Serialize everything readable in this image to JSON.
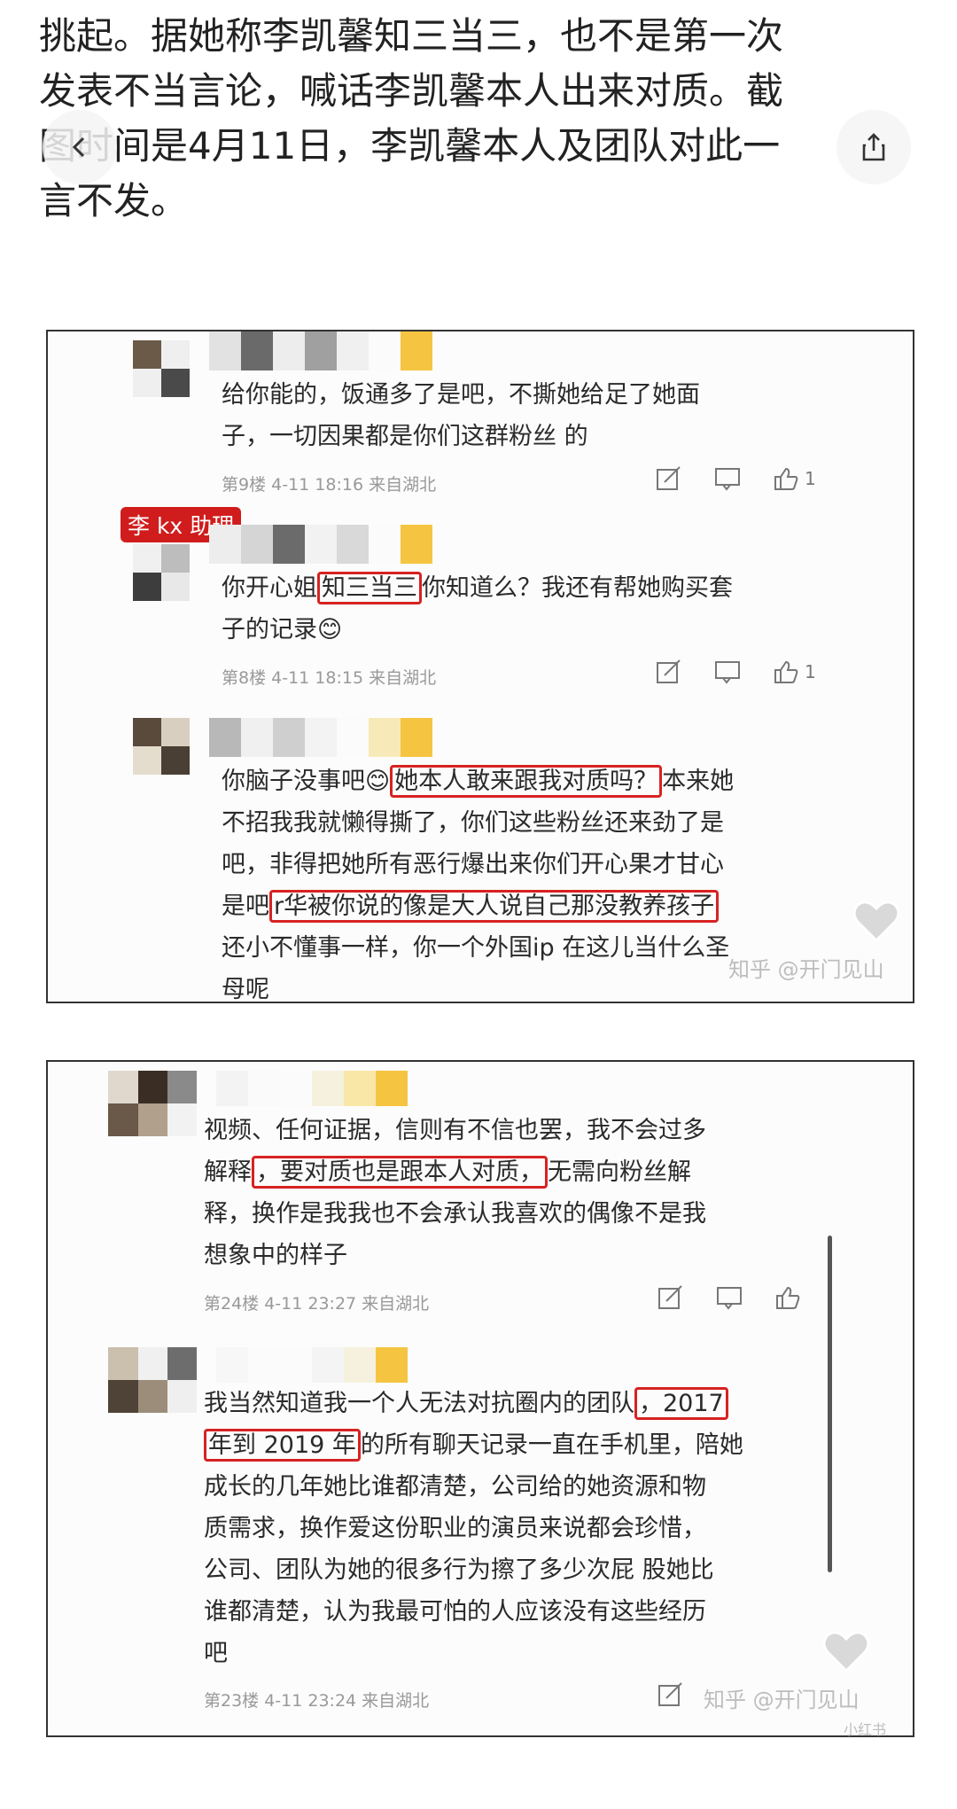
{
  "article": {
    "lines": [
      "挑起。据她称李凯馨知三当三，也不是第一次",
      "发表不当言论，喊话李凯馨本人出来对质。截",
      "图时间是4月11日，李凯馨本人及团队对此一",
      "言不发。"
    ]
  },
  "nav": {
    "back_icon": "chevron-left-icon",
    "share_icon": "share-icon"
  },
  "screenshot1": {
    "c1": {
      "line1": "给你能的，饭通多了是吧，不撕她给足了她面",
      "line2": "子，一切因果都是你们这群粉丝    的",
      "meta": "第9楼 4-11 18:16 来自湖北",
      "likes": "1"
    },
    "tag": "李 kx 助理",
    "c2": {
      "pre": "你开心姐",
      "hl": "知三当三",
      "post": "你知道么？我还有帮她购买套",
      "line2": "子的记录😊",
      "meta": "第8楼 4-11 18:15 来自湖北",
      "likes": "1"
    },
    "c3": {
      "pre": "你脑子没事吧😊",
      "hl1": "她本人敢来跟我对质吗？",
      "post": "本来她",
      "line2": "不招我我就懒得撕了，你们这些粉丝还来劲了是",
      "line3": "吧，非得把她所有恶行爆出来你们开心果才甘心",
      "pre4": "是吧",
      "hl2": "r华被你说的像是大人说自己那没教养孩子",
      "line5": "还小不懂事一样，你一个外国ip 在这儿当什么圣",
      "line6": "母呢"
    },
    "watermark": "知乎 @开门见山"
  },
  "screenshot2": {
    "c1": {
      "line1": "视频、任何证据，信则有不信也罢，我不会过多",
      "pre2": "解释",
      "hl": "，要对质也是跟本人对质，",
      "post2": "无需向粉丝解",
      "line3": "释，换作是我我也不会承认我喜欢的偶像不是我",
      "line4": "想象中的样子",
      "meta": "第24楼 4-11 23:27 来自湖北"
    },
    "c2": {
      "pre1": "我当然知道我一个人无法对抗圈内的团队",
      "hl1": "，2017",
      "hl2": "年到 2019 年",
      "post2": "的所有聊天记录一直在手机里，陪她",
      "line3": "成长的几年她比谁都清楚，公司给的她资源和物",
      "line4": "质需求，换作爱这份职业的演员来说都会珍惜，",
      "line5": "公司、团队为她的很多行为擦了多少次屁 股她比",
      "line6": "谁都清楚，认为我最可怕的人应该没有这些经历",
      "line7": "吧",
      "meta": "第23楼 4-11 23:24 来自湖北"
    },
    "watermark": "知乎 @开门见山",
    "corner_mark": "小红书"
  },
  "colors": {
    "highlight": "#d72222",
    "tag_bg": "#d01c1c",
    "avatar_a": "#5a4a3c",
    "avatar_b": "#f5c542"
  }
}
